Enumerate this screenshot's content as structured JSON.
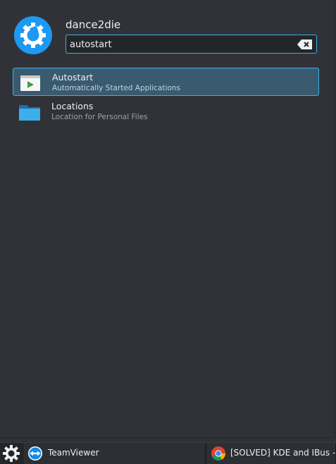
{
  "user": {
    "name": "dance2die"
  },
  "search": {
    "value": "autostart"
  },
  "results": [
    {
      "title": "Autostart",
      "subtitle": "Automatically Started Applications",
      "icon": "autostart-play-icon",
      "selected": true
    },
    {
      "title": "Locations",
      "subtitle": "Location for Personal Files",
      "icon": "folder-icon",
      "selected": false
    }
  ],
  "taskbar": {
    "menu_icon": "kde-gear-icon",
    "tasks": [
      {
        "label": "TeamViewer",
        "icon": "teamviewer-icon"
      },
      {
        "label": "[SOLVED] KDE and IBus -",
        "icon": "chrome-icon"
      }
    ]
  },
  "colors": {
    "accent": "#3daee9",
    "background": "#303237",
    "selection": "#3a5a6f",
    "taskbar": "#232629"
  }
}
